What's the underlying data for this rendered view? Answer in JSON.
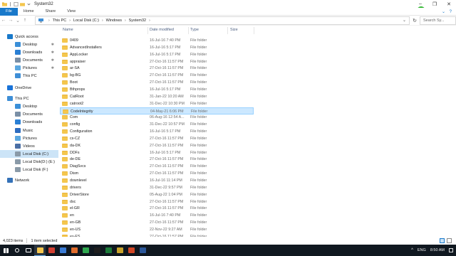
{
  "window": {
    "title": "System32",
    "controls": {
      "minimize": "–",
      "maximize": "❐",
      "close": "✕"
    }
  },
  "ribbon": {
    "tabs": [
      "File",
      "Home",
      "Share",
      "View"
    ],
    "expand_glyph": "⌄",
    "help_glyph": "?"
  },
  "address": {
    "back": "←",
    "forward": "→",
    "recent": "⌄",
    "up": "↑",
    "crumbs": [
      "This PC",
      "Local Disk (C:)",
      "Windows",
      "System32"
    ],
    "crumb_sep": "›",
    "dropdown": "⌄",
    "refresh": "↻",
    "search_placeholder": "Search Sy..."
  },
  "nav": {
    "items": [
      {
        "label": "Quick access",
        "icon": "star-icon",
        "color": "#1979ca",
        "pinned": false
      },
      {
        "label": "Desktop",
        "icon": "desktop-icon",
        "color": "#3b8fd8",
        "pinned": true
      },
      {
        "label": "Downloads",
        "icon": "download-icon",
        "color": "#2a7fd4",
        "pinned": true
      },
      {
        "label": "Documents",
        "icon": "documents-icon",
        "color": "#7a8fa6",
        "pinned": true
      },
      {
        "label": "Pictures",
        "icon": "pictures-icon",
        "color": "#5ba7e0",
        "pinned": true
      },
      {
        "label": "This PC",
        "icon": "computer-icon",
        "color": "#3e8ed6",
        "pinned": false
      },
      {
        "label": "OneDrive",
        "icon": "cloud-icon",
        "color": "#1a73d8",
        "pinned": false
      },
      {
        "label": "This PC",
        "icon": "computer-icon",
        "color": "#3e8ed6",
        "pinned": false
      },
      {
        "label": "Desktop",
        "icon": "desktop-icon",
        "color": "#3b8fd8",
        "pinned": false
      },
      {
        "label": "Documents",
        "icon": "documents-icon",
        "color": "#7a8fa6",
        "pinned": false
      },
      {
        "label": "Downloads",
        "icon": "download-icon",
        "color": "#2a7fd4",
        "pinned": false
      },
      {
        "label": "Music",
        "icon": "music-icon",
        "color": "#2d6cc0",
        "pinned": false
      },
      {
        "label": "Pictures",
        "icon": "pictures-icon",
        "color": "#5ba7e0",
        "pinned": false
      },
      {
        "label": "Videos",
        "icon": "videos-icon",
        "color": "#4a6fa5",
        "pinned": false
      },
      {
        "label": "Local Disk (C:)",
        "icon": "drive-icon",
        "color": "#8a9aa8",
        "pinned": false,
        "selected": true
      },
      {
        "label": "Local Disk(D:) (E:)",
        "icon": "drive-icon",
        "color": "#8a9aa8",
        "pinned": false
      },
      {
        "label": "Local Disk  (F:)",
        "icon": "drive-icon",
        "color": "#8a9aa8",
        "pinned": false
      },
      {
        "label": "Network",
        "icon": "network-icon",
        "color": "#3572b8",
        "pinned": false
      }
    ],
    "pin_glyph": "✱"
  },
  "columns": {
    "name": "Name",
    "date": "Date modified",
    "type": "Type",
    "size": "Size"
  },
  "files": [
    {
      "name": "0409",
      "date": "16-Jul-16 7:40 PM",
      "type": "File folder"
    },
    {
      "name": "AdvancedInstallers",
      "date": "16-Jul-16 5:17 PM",
      "type": "File folder"
    },
    {
      "name": "AppLocker",
      "date": "16-Jul-16 5:17 PM",
      "type": "File folder"
    },
    {
      "name": "appraiser",
      "date": "27-Oct-16 11:57 PM",
      "type": "File folder"
    },
    {
      "name": "ar-SA",
      "date": "27-Oct-16 11:57 PM",
      "type": "File folder"
    },
    {
      "name": "bg-BG",
      "date": "27-Oct-16 11:57 PM",
      "type": "File folder"
    },
    {
      "name": "Boot",
      "date": "27-Oct-16 11:57 PM",
      "type": "File folder"
    },
    {
      "name": "Bthprops",
      "date": "16-Jul-16 5:17 PM",
      "type": "File folder"
    },
    {
      "name": "CatRoot",
      "date": "31-Jan-22 10:20 AM",
      "type": "File folder"
    },
    {
      "name": "catroot2",
      "date": "31-Dec-22 10:30 PM",
      "type": "File folder"
    },
    {
      "name": "CodeIntegrity",
      "date": "04-May-21 6:06 PM",
      "type": "File folder",
      "selected": true
    },
    {
      "name": "Com",
      "date": "06-Aug-16 12:54 A...",
      "type": "File folder"
    },
    {
      "name": "config",
      "date": "31-Dec-22 10:57 PM",
      "type": "File folder"
    },
    {
      "name": "Configuration",
      "date": "16-Jul-16 5:17 PM",
      "type": "File folder"
    },
    {
      "name": "cs-CZ",
      "date": "27-Oct-16 11:57 PM",
      "type": "File folder"
    },
    {
      "name": "da-DK",
      "date": "27-Oct-16 11:57 PM",
      "type": "File folder"
    },
    {
      "name": "DDFs",
      "date": "16-Jul-16 5:17 PM",
      "type": "File folder"
    },
    {
      "name": "de-DE",
      "date": "27-Oct-16 11:57 PM",
      "type": "File folder"
    },
    {
      "name": "DiagSvcs",
      "date": "27-Oct-16 11:57 PM",
      "type": "File folder"
    },
    {
      "name": "Dism",
      "date": "27-Oct-16 11:57 PM",
      "type": "File folder"
    },
    {
      "name": "downlevel",
      "date": "16-Jul-16 11:14 PM",
      "type": "File folder"
    },
    {
      "name": "drivers",
      "date": "31-Dec-22 9:57 PM",
      "type": "File folder"
    },
    {
      "name": "DriverStore",
      "date": "05-Aug-22 1:04 PM",
      "type": "File folder"
    },
    {
      "name": "dsc",
      "date": "27-Oct-16 11:57 PM",
      "type": "File folder"
    },
    {
      "name": "el-GR",
      "date": "27-Oct-16 11:57 PM",
      "type": "File folder"
    },
    {
      "name": "en",
      "date": "16-Jul-16 7:40 PM",
      "type": "File folder"
    },
    {
      "name": "en-GB",
      "date": "27-Oct-16 11:57 PM",
      "type": "File folder"
    },
    {
      "name": "en-US",
      "date": "22-Nov-22 9:27 AM",
      "type": "File folder"
    },
    {
      "name": "es-ES",
      "date": "27-Oct-16 11:57 PM",
      "type": "File folder"
    }
  ],
  "status": {
    "items": "4,023 items",
    "selected": "1 item selected"
  },
  "taskbar": {
    "apps": [
      {
        "icon": "start-icon",
        "color": "#ffffff"
      },
      {
        "icon": "search-icon",
        "color": "#ffffff"
      },
      {
        "icon": "task-view-icon",
        "color": "#ffffff"
      },
      {
        "icon": "file-explorer-icon",
        "color": "#f4c64e",
        "active": true
      },
      {
        "icon": "app-icon",
        "color": "#d23f31"
      },
      {
        "icon": "app-icon",
        "color": "#3a7bd5"
      },
      {
        "icon": "app-icon",
        "color": "#e06c2c"
      },
      {
        "icon": "app-icon",
        "color": "#2fa84f"
      },
      {
        "icon": "app-icon",
        "color": "#1e1e1e"
      },
      {
        "icon": "app-icon",
        "color": "#1d7b3a"
      },
      {
        "icon": "app-icon",
        "color": "#c8a32b"
      },
      {
        "icon": "app-icon",
        "color": "#d24726"
      },
      {
        "icon": "app-icon",
        "color": "#2b579a"
      }
    ],
    "tray": {
      "chevron": "^",
      "language": "ENG",
      "time": "8:50 AM"
    }
  }
}
